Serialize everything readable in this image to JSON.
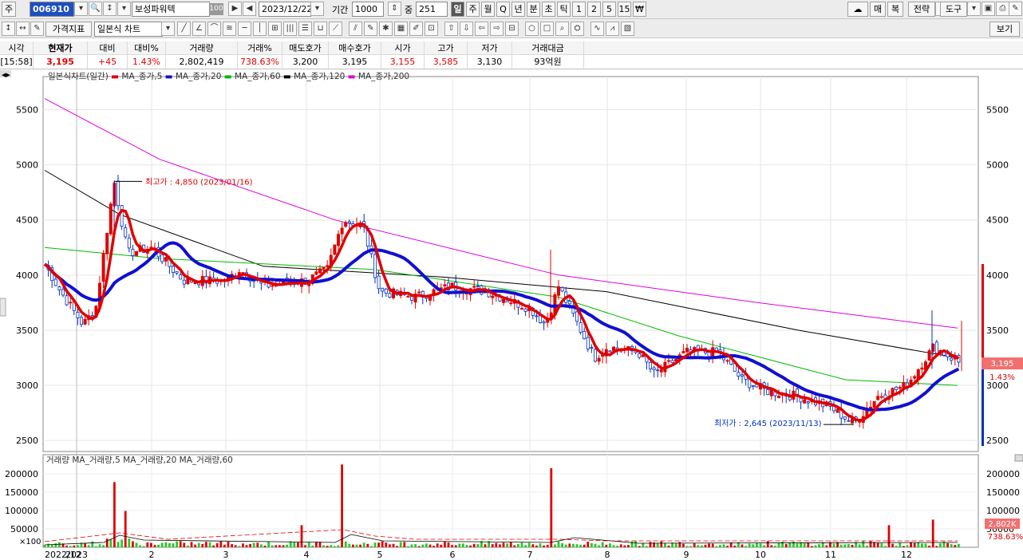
{
  "toolbar": {
    "market_label": "주",
    "code": "006910",
    "name": "보성파워텍",
    "name_badge": "100",
    "date": "2023/12/22",
    "period_label": "기간",
    "period_value": "1000",
    "overlap_label": "중",
    "overlap_value": "251",
    "timeframes": [
      "일",
      "주",
      "월",
      "Q",
      "년",
      "분",
      "초",
      "틱",
      "1",
      "2",
      "5",
      "15",
      "₩"
    ],
    "right_buttons": [
      "매",
      "복",
      "전략",
      "도구"
    ],
    "indicator_button": "가격지표",
    "chart_type": "일본식 차트",
    "view_button": "보기"
  },
  "quote": {
    "headers": [
      "시각",
      "현재가",
      "대비",
      "대비%",
      "거래량",
      "거래%",
      "매도호가",
      "매수호가",
      "시가",
      "고가",
      "저가",
      "거래대금"
    ],
    "values": [
      "[15:58]",
      "3,195",
      "+45",
      "1.43%",
      "2,802,419",
      "738.63%",
      "3,200",
      "3,195",
      "3,155",
      "3,585",
      "3,130",
      "93억원"
    ]
  },
  "colors": {
    "up": "#e00000",
    "down": "#0030c0",
    "ma5": "#e00000",
    "ma20": "#1010d0",
    "ma60": "#00bb00",
    "ma120": "#000000",
    "ma200": "#dd00dd"
  },
  "price_panel": {
    "legend": [
      "일본식차트(일간)",
      "MA_종가,5",
      "MA_종가,20",
      "MA_종가,60",
      "MA_종가,120",
      "MA_종가,200"
    ],
    "high_label": "최고가 : 4,850 (2023/01/16)",
    "low_label": "최저가 : 2,645 (2023/11/13)",
    "current_price_tag": "3,195",
    "current_pct_tag": "1.43%"
  },
  "volume_panel": {
    "legend": [
      "거래량",
      "MA_거래량,5",
      "MA_거래량,20",
      "MA_거래량,60"
    ],
    "scale_label": "×100",
    "current_volume_tag": "2,802K",
    "current_volume_pct_tag": "738.63%"
  },
  "chart_data": {
    "type": "candlestick",
    "x_labels": [
      "2022/12",
      "2023",
      "2",
      "3",
      "4",
      "5",
      "6",
      "7",
      "8",
      "9",
      "10",
      "11",
      "12"
    ],
    "y_ticks": [
      2500,
      3000,
      3500,
      4000,
      4500,
      5000,
      5500
    ],
    "volume_ticks": [
      50000,
      100000,
      150000,
      200000
    ],
    "ylim": [
      2400,
      5800
    ],
    "volume_ylim": [
      0,
      230000
    ],
    "trend": [
      {
        "x": "2022/12",
        "y": 4100
      },
      {
        "x": "2023",
        "y": 3600
      },
      {
        "x": "1/16",
        "y": 4850
      },
      {
        "x": "2",
        "y": 4250
      },
      {
        "x": "3",
        "y": 3950
      },
      {
        "x": "4",
        "y": 3900
      },
      {
        "x": "4/mid",
        "y": 4600
      },
      {
        "x": "5",
        "y": 3850
      },
      {
        "x": "6",
        "y": 3900
      },
      {
        "x": "7",
        "y": 3800
      },
      {
        "x": "8",
        "y": 3300
      },
      {
        "x": "9",
        "y": 3300
      },
      {
        "x": "10",
        "y": 3050
      },
      {
        "x": "11/13",
        "y": 2645
      },
      {
        "x": "12",
        "y": 3100
      },
      {
        "x": "12/22",
        "y": 3195
      }
    ]
  }
}
